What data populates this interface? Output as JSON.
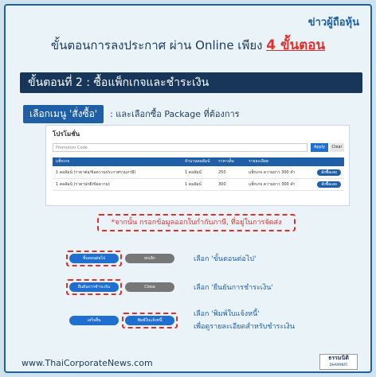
{
  "brand": {
    "name": "ข่าวผู้ถือหุ้น"
  },
  "headline": {
    "text": "ขั้นตอนการลงประกาศ ผ่าน Online เพียง ",
    "highlight": "4 ขั้นตอน"
  },
  "step": {
    "title": "ขั้นตอนที่ 2 :  ซื้อแพ็กเกจและชำระเงิน"
  },
  "menu": {
    "pill": "เลือกเมนู 'สั่งซื้อ'",
    "text": ":  และเลือกซื้อ Package ที่ต้องการ"
  },
  "panel": {
    "title": "โปรโมชั่น",
    "search_placeholder": "Promotion Code",
    "apply_label": "Apply",
    "clear_label": "Clear",
    "columns": [
      "แพ็กเกจ",
      "จำนวนคอลัมน์",
      "ราคาเต็ม",
      "รายละเอียด"
    ],
    "rows": [
      {
        "name": "1 คอลัมน์ (ราคาต่อ/ข้อความประกาศรวมภาษี)",
        "qty": "1 คอลัมน์",
        "price": "250",
        "detail": "แพ็กเกจ ความยาว 300 คำ",
        "button": "สั่งซื้อเลย"
      },
      {
        "name": "1 คอลัมน์ (ราคาปกติ/ข้อความ)",
        "qty": "1 คอลัมน์",
        "price": "300",
        "detail": "แพ็กเกจ ความยาว 300 คำ",
        "button": "สั่งซื้อเลย"
      }
    ]
  },
  "note": {
    "text": "*จากนั้น กรอกข้อมูลออกใบกำกับภาษี, ที่อยู่ในการจัดส่ง"
  },
  "actions": [
    {
      "left": "ขั้นตอนต่อไป",
      "right": "ยกเลิก",
      "desc": "เลือก 'ขั้นตอนต่อไป'"
    },
    {
      "left": "ยืนยันการชำระเงิน",
      "right": "Close",
      "desc": "เลือก 'ยืนยันการชำระเงิน'"
    },
    {
      "left": "เสร็จสิ้น",
      "right": "พิมพ์ใบแจ้งหนี้",
      "desc": "เลือก 'พิมพ์ใบแจ้งหนี้'",
      "desc2": "เพื่อดูรายละเอียดสำหรับชำระเงิน"
    }
  ],
  "footer": {
    "site": "www.ThaiCorporateNews.com",
    "logo": "ธรรมนิติ",
    "logo_sub": "DHARMNITI"
  }
}
